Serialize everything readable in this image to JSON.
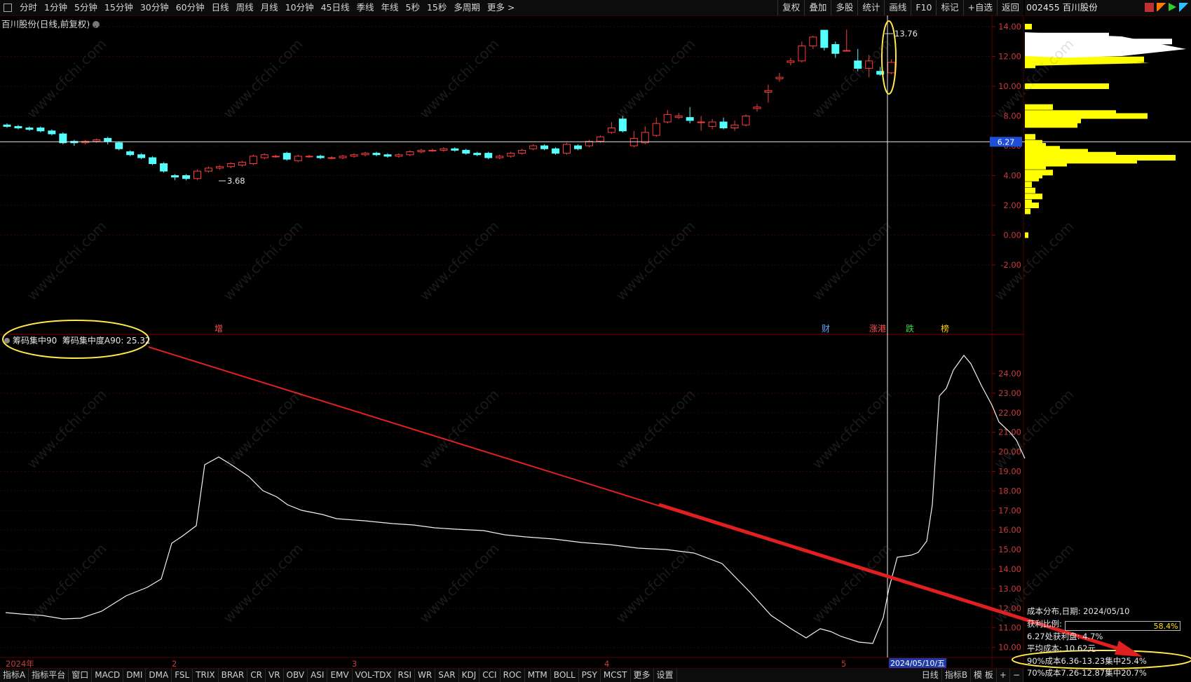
{
  "toolbar": {
    "periods": [
      "分时",
      "1分钟",
      "5分钟",
      "15分钟",
      "30分钟",
      "60分钟",
      "日线",
      "周线",
      "月线",
      "10分钟",
      "45日线",
      "季线",
      "年线",
      "5秒",
      "15秒",
      "多周期",
      "更多 >"
    ],
    "right_items": [
      "复权",
      "叠加",
      "多股",
      "统计",
      "画线",
      "F10",
      "标记",
      "+自选",
      "返回"
    ]
  },
  "stock_header": {
    "code_name": "002455 百川股份"
  },
  "main_chart": {
    "title": "百川股份(日线,前复权)",
    "y_ticks": [
      "14.00",
      "12.00",
      "10.00",
      "8.00",
      "6.00",
      "4.00",
      "2.00",
      "0.00",
      "-2.00"
    ],
    "crosshair_price": "6.27",
    "high_label": "13.76",
    "low_label": "3.68",
    "markers": [
      {
        "text": "增",
        "color": "#ff5050"
      },
      {
        "text": "财",
        "color": "#5fa8ff"
      },
      {
        "text": "涨港",
        "color": "#ff5050"
      },
      {
        "text": "跌",
        "color": "#3ddc3d"
      },
      {
        "text": "榜",
        "color": "#ffd000"
      }
    ]
  },
  "indicator": {
    "name": "筹码集中90",
    "value_label": "筹码集中度A90: 25.32",
    "y_ticks": [
      "24.00",
      "23.00",
      "22.00",
      "21.00",
      "20.00",
      "19.00",
      "18.00",
      "17.00",
      "16.00",
      "15.00",
      "14.00",
      "13.00",
      "12.00",
      "11.00",
      "10.00"
    ]
  },
  "time_axis": {
    "labels": [
      "2024年",
      "2",
      "3",
      "4",
      "5"
    ],
    "cursor_date": "2024/05/10/五"
  },
  "bottom_tabs": [
    "指标A",
    "指标平台",
    "窗口",
    "MACD",
    "DMI",
    "DMA",
    "FSL",
    "TRIX",
    "BRAR",
    "CR",
    "VR",
    "OBV",
    "ASI",
    "EMV",
    "VOL-TDX",
    "RSI",
    "WR",
    "SAR",
    "KDJ",
    "CCI",
    "ROC",
    "MTM",
    "BOLL",
    "PSY",
    "MCST",
    "更多",
    "设置"
  ],
  "bottom_right": [
    "日线",
    "指标B",
    "模 板",
    "+",
    "−"
  ],
  "cost_info": {
    "date_line": "成本分布,日期: 2024/05/10",
    "profit_label": "获利比例:",
    "profit_value": "58.4%",
    "loss_line": "6.27处获利盘: 4.7%",
    "avg_cost": "平均成本: 10.62元",
    "cost90": "90%成本6.36-13.23集中25.4%",
    "cost70": "70%成本7.26-12.87集中20.7%"
  },
  "watermark": "www.cfchi.com",
  "colors": {
    "up": "#ff3c3c",
    "down": "#54ffff",
    "line": "#ffffff",
    "chips": "#ffff00",
    "annotation": "#ffe94d",
    "arrow": "#e02020"
  }
}
